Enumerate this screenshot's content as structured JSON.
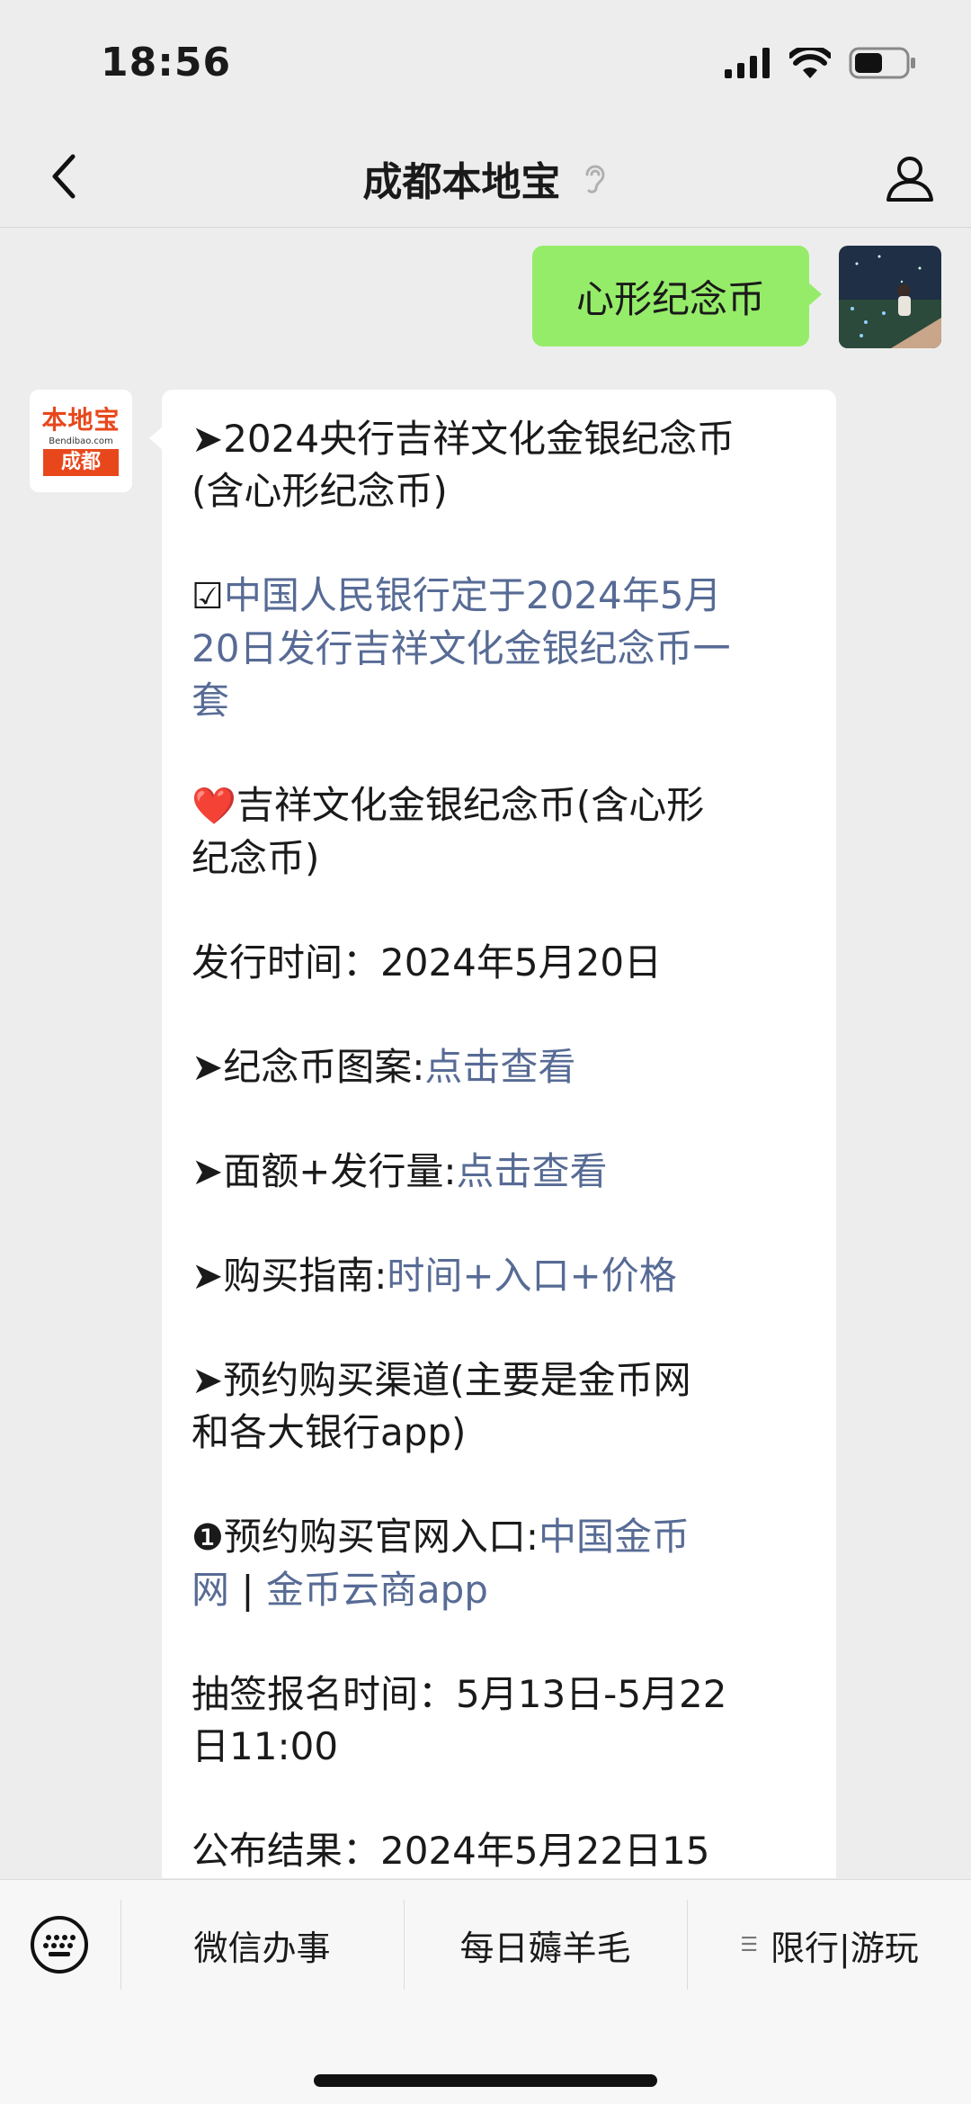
{
  "status_bar": {
    "time": "18:56"
  },
  "nav": {
    "title": "成都本地宝"
  },
  "chat": {
    "outgoing_text": "心形纪念币",
    "bot_logo": {
      "top": "本地宝",
      "domain": "Bendibao.com",
      "city": "成都"
    },
    "lines": [
      {
        "t": "➤2024央行吉祥文化金银纪念币"
      },
      {
        "t": "(含心形纪念币)"
      },
      {
        "t": ""
      },
      {
        "p": "☑",
        "l": "中国人民银行定于2024年5月"
      },
      {
        "l": "20日发行吉祥文化金银纪念币一"
      },
      {
        "l": "套"
      },
      {
        "t": ""
      },
      {
        "p": "❤️",
        "t": "吉祥文化金银纪念币(含心形"
      },
      {
        "t": "纪念币)"
      },
      {
        "t": ""
      },
      {
        "t": "发行时间：2024年5月20日"
      },
      {
        "t": ""
      },
      {
        "t": "➤纪念币图案:",
        "l": "点击查看"
      },
      {
        "t": ""
      },
      {
        "t": "➤面额+发行量:",
        "l": "点击查看"
      },
      {
        "t": ""
      },
      {
        "t": "➤购买指南:",
        "l": "时间+入口+价格"
      },
      {
        "t": ""
      },
      {
        "t": "➤预约购买渠道(主要是金币网"
      },
      {
        "t": "和各大银行app)"
      },
      {
        "t": ""
      },
      {
        "p": "❶",
        "t": "预约购买官网入口:",
        "l": "中国金币"
      },
      {
        "l": "网",
        "t2": " | ",
        "l2": "金币云商app"
      },
      {
        "t": ""
      },
      {
        "t": "抽签报名时间：5月13日-5月22"
      },
      {
        "t": "日11:00"
      },
      {
        "t": ""
      },
      {
        "t": "公布结果：2024年5月22日15"
      }
    ]
  },
  "bottom_menu": {
    "items": [
      "微信办事",
      "每日薅羊毛",
      "限行|游玩"
    ]
  },
  "colors": {
    "link": "#576b95",
    "outgoing_bubble": "#95ec69",
    "brand": "#e8471c"
  }
}
